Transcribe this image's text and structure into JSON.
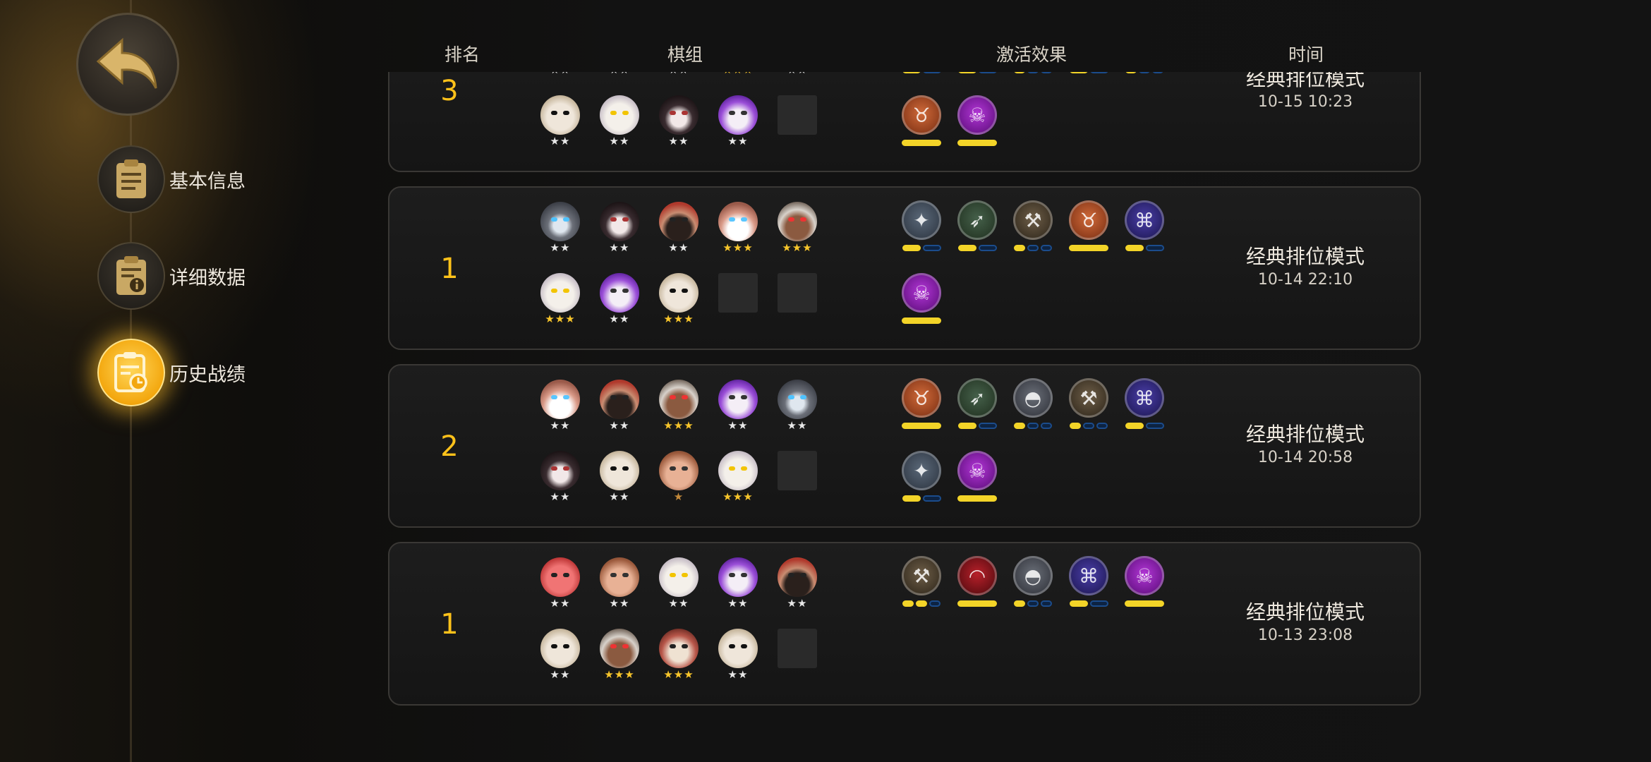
{
  "header": {
    "rank": "排名",
    "lineup": "棋组",
    "traits": "激活效果",
    "time": "时间"
  },
  "sidebar": {
    "items": [
      {
        "label": "基本信息",
        "icon": "clipboard-icon",
        "active": false
      },
      {
        "label": "详细数据",
        "icon": "info-doc-icon",
        "active": false
      },
      {
        "label": "历史战绩",
        "icon": "history-clock-icon",
        "active": true
      }
    ]
  },
  "matches": [
    {
      "rank": "3",
      "mode": "经典排位模式",
      "time": "10-15 10:23",
      "pieces": [
        {
          "hero": "hooded-assassin",
          "stars": "★★"
        },
        {
          "hero": "pale-beast",
          "stars": "★★"
        },
        {
          "hero": "goggle-brute",
          "stars": "★★"
        },
        {
          "hero": "goggle-dwarf",
          "stars": "★★★"
        },
        {
          "hero": "bearded-pirate",
          "stars": "★★"
        },
        {
          "hero": "masked-warrior",
          "stars": "★★"
        },
        {
          "hero": "pale-beast",
          "stars": "★★"
        },
        {
          "hero": "dark-rogue",
          "stars": "★★"
        },
        {
          "hero": "purple-witch",
          "stars": "★★"
        },
        {
          "hero": "empty",
          "stars": ""
        }
      ],
      "traits": [
        {
          "icon": "paw-icon",
          "tier": 1,
          "max": 2
        },
        {
          "icon": "bow-icon",
          "tier": 1,
          "max": 2
        },
        {
          "icon": "axe-icon",
          "tier": 1,
          "max": 3
        },
        {
          "icon": "fish-bone-icon",
          "tier": 1,
          "max": 2
        },
        {
          "icon": "helmet-icon",
          "tier": 1,
          "max": 3
        },
        {
          "icon": "horned-helm-icon",
          "tier": 1,
          "max": 1
        },
        {
          "icon": "skull-icon",
          "tier": 1,
          "max": 1
        }
      ]
    },
    {
      "rank": "1",
      "mode": "经典排位模式",
      "time": "10-14 22:10",
      "pieces": [
        {
          "hero": "hooded-assassin",
          "stars": "★★"
        },
        {
          "hero": "dark-rogue",
          "stars": "★★"
        },
        {
          "hero": "bearded-pirate",
          "stars": "★★"
        },
        {
          "hero": "goggle-dwarf",
          "stars": "★★★"
        },
        {
          "hero": "scarred-veteran",
          "stars": "★★★"
        },
        {
          "hero": "pale-beast",
          "stars": "★★★"
        },
        {
          "hero": "purple-witch",
          "stars": "★★"
        },
        {
          "hero": "masked-warrior",
          "stars": "★★★"
        },
        {
          "hero": "empty",
          "stars": ""
        },
        {
          "hero": "empty",
          "stars": ""
        }
      ],
      "traits": [
        {
          "icon": "paw-icon",
          "tier": 1,
          "max": 2
        },
        {
          "icon": "bow-icon",
          "tier": 1,
          "max": 2
        },
        {
          "icon": "axe-icon",
          "tier": 1,
          "max": 3
        },
        {
          "icon": "horned-helm-icon",
          "tier": 1,
          "max": 1
        },
        {
          "icon": "fish-bone-icon",
          "tier": 1,
          "max": 2
        },
        {
          "icon": "skull-icon",
          "tier": 1,
          "max": 1
        }
      ]
    },
    {
      "rank": "2",
      "mode": "经典排位模式",
      "time": "10-14 20:58",
      "pieces": [
        {
          "hero": "goggle-dwarf",
          "stars": "★★"
        },
        {
          "hero": "bearded-pirate",
          "stars": "★★"
        },
        {
          "hero": "scarred-veteran",
          "stars": "★★★"
        },
        {
          "hero": "purple-witch",
          "stars": "★★"
        },
        {
          "hero": "hooded-assassin",
          "stars": "★★"
        },
        {
          "hero": "dark-rogue",
          "stars": "★★"
        },
        {
          "hero": "masked-warrior",
          "stars": "★★"
        },
        {
          "hero": "goggle-brute",
          "stars": "★"
        },
        {
          "hero": "pale-beast",
          "stars": "★★★"
        },
        {
          "hero": "empty",
          "stars": ""
        }
      ],
      "traits": [
        {
          "icon": "horned-helm-icon",
          "tier": 1,
          "max": 1
        },
        {
          "icon": "bow-icon",
          "tier": 1,
          "max": 2
        },
        {
          "icon": "helmet-icon",
          "tier": 1,
          "max": 3
        },
        {
          "icon": "axe-icon",
          "tier": 1,
          "max": 3
        },
        {
          "icon": "fish-bone-icon",
          "tier": 1,
          "max": 2
        },
        {
          "icon": "paw-icon",
          "tier": 1,
          "max": 2
        },
        {
          "icon": "skull-icon",
          "tier": 1,
          "max": 1
        }
      ]
    },
    {
      "rank": "1",
      "mode": "经典排位模式",
      "time": "10-13 23:08",
      "pieces": [
        {
          "hero": "red-demon",
          "stars": "★★"
        },
        {
          "hero": "goggle-brute",
          "stars": "★★"
        },
        {
          "hero": "pale-beast",
          "stars": "★★"
        },
        {
          "hero": "purple-witch",
          "stars": "★★"
        },
        {
          "hero": "bearded-pirate",
          "stars": "★★"
        },
        {
          "hero": "masked-warrior",
          "stars": "★★"
        },
        {
          "hero": "scarred-veteran",
          "stars": "★★★"
        },
        {
          "hero": "owl-mask",
          "stars": "★★★"
        },
        {
          "hero": "masked-warrior",
          "stars": "★★"
        },
        {
          "hero": "empty",
          "stars": ""
        }
      ],
      "traits": [
        {
          "icon": "axe-icon",
          "tier": 2,
          "max": 3
        },
        {
          "icon": "crimson-arc-icon",
          "tier": 1,
          "max": 1
        },
        {
          "icon": "helmet-icon",
          "tier": 1,
          "max": 3
        },
        {
          "icon": "fish-bone-icon",
          "tier": 1,
          "max": 2
        },
        {
          "icon": "skull-icon",
          "tier": 1,
          "max": 1
        }
      ]
    }
  ],
  "colors": {
    "accent": "#ffc21a",
    "star_white": "#e8e8e8",
    "star_gold": "#f7c52b",
    "star_bronze": "#c58a3a"
  }
}
